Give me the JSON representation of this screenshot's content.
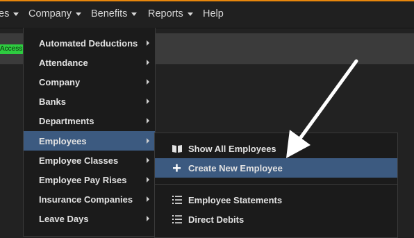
{
  "navbar": {
    "items": [
      {
        "label": "es"
      },
      {
        "label": "Company"
      },
      {
        "label": "Benefits"
      },
      {
        "label": "Reports"
      },
      {
        "label": "Help"
      }
    ]
  },
  "badge": {
    "label": "Access",
    "color": "#2ecc40"
  },
  "menu": {
    "items": [
      {
        "label": "Automated Deductions"
      },
      {
        "label": "Attendance"
      },
      {
        "label": "Company"
      },
      {
        "label": "Banks"
      },
      {
        "label": "Departments"
      },
      {
        "label": "Employees"
      },
      {
        "label": "Employee Classes"
      },
      {
        "label": "Employee Pay Rises"
      },
      {
        "label": "Insurance Companies"
      },
      {
        "label": "Leave Days"
      }
    ]
  },
  "submenu": {
    "items": [
      {
        "label": "Show All Employees",
        "icon": "book-icon"
      },
      {
        "label": "Create New Employee",
        "icon": "plus-icon"
      },
      {
        "label": "Employee Statements",
        "icon": "list-icon"
      },
      {
        "label": "Direct Debits",
        "icon": "list-icon"
      }
    ]
  },
  "colors": {
    "accent_top": "#e8870c",
    "active_highlight": "#3c5a80",
    "background": "#222222"
  }
}
